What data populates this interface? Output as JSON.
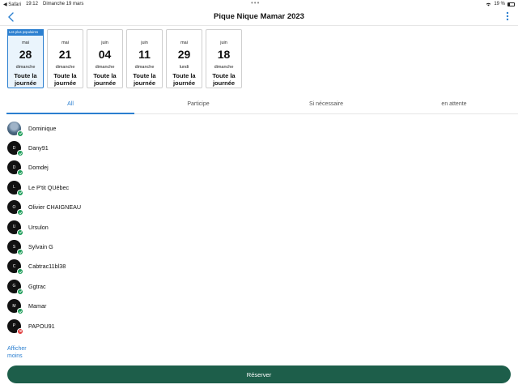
{
  "status_bar": {
    "carrier": "◀ Safari",
    "time": "19:12",
    "date": "Dimanche 19 mars",
    "battery": "19 %"
  },
  "header": {
    "title": "Pique Nique Mamar 2023"
  },
  "dates": [
    {
      "badge": "Les plus populaires",
      "month": "mai",
      "day": "28",
      "weekday": "dimanche",
      "slot": "Toute la journée",
      "selected": true
    },
    {
      "badge": "",
      "month": "mai",
      "day": "21",
      "weekday": "dimanche",
      "slot": "Toute la journée",
      "selected": false
    },
    {
      "badge": "",
      "month": "juin",
      "day": "04",
      "weekday": "dimanche",
      "slot": "Toute la journée",
      "selected": false
    },
    {
      "badge": "",
      "month": "juin",
      "day": "11",
      "weekday": "dimanche",
      "slot": "Toute la journée",
      "selected": false
    },
    {
      "badge": "",
      "month": "mai",
      "day": "29",
      "weekday": "lundi",
      "slot": "Toute la journée",
      "selected": false
    },
    {
      "badge": "",
      "month": "juin",
      "day": "18",
      "weekday": "dimanche",
      "slot": "Toute la journée",
      "selected": false
    }
  ],
  "tabs": [
    {
      "label": "All",
      "active": true
    },
    {
      "label": "Participe",
      "active": false
    },
    {
      "label": "Si nécessaire",
      "active": false
    },
    {
      "label": "en attente",
      "active": false
    }
  ],
  "participants": [
    {
      "initial": "",
      "name": "Dominique",
      "status": "yes",
      "photo": true
    },
    {
      "initial": "D",
      "name": "Dany91",
      "status": "yes",
      "photo": false
    },
    {
      "initial": "D",
      "name": "Domdej",
      "status": "yes",
      "photo": false
    },
    {
      "initial": "L",
      "name": "Le P'tit QUébec",
      "status": "yes",
      "photo": false
    },
    {
      "initial": "O",
      "name": "Olivier CHAIGNEAU",
      "status": "yes",
      "photo": false
    },
    {
      "initial": "U",
      "name": "Ursulon",
      "status": "yes",
      "photo": false
    },
    {
      "initial": "S",
      "name": "Sylvain G",
      "status": "yes",
      "photo": false
    },
    {
      "initial": "C",
      "name": "Cabtrac11bl38",
      "status": "yes",
      "photo": false
    },
    {
      "initial": "G",
      "name": "Ggtrac",
      "status": "yes",
      "photo": false
    },
    {
      "initial": "M",
      "name": "Mamar",
      "status": "yes",
      "photo": false
    },
    {
      "initial": "P",
      "name": "PAPOU91",
      "status": "no",
      "photo": false
    }
  ],
  "show_less_label": "Afficher moins",
  "reserve_label": "Réserver",
  "colors": {
    "accent": "#2b7fd0",
    "primary_button": "#1d5e4a",
    "status_ok": "#1f9e5a",
    "status_no": "#e03a3a"
  }
}
